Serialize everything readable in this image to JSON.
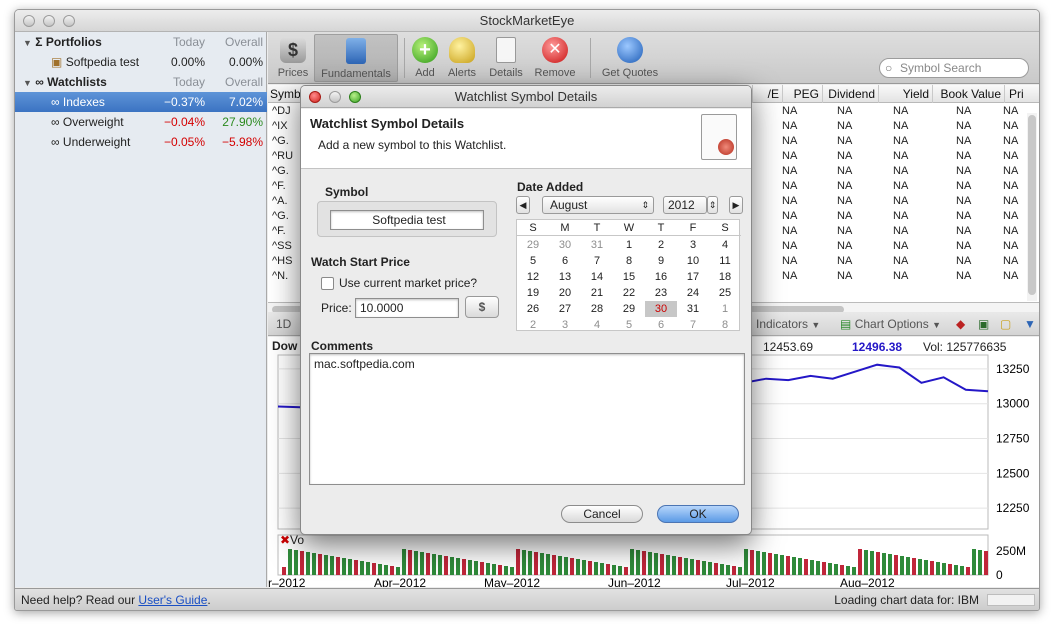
{
  "app": {
    "title": "StockMarketEye"
  },
  "sidebar": {
    "portfolios_header": {
      "label": "Portfolios",
      "today": "Today",
      "overall": "Overall"
    },
    "portfolios": [
      {
        "label": "Softpedia test",
        "today": "0.00%",
        "overall": "0.00%"
      }
    ],
    "watchlists_header": {
      "label": "Watchlists",
      "today": "Today",
      "overall": "Overall"
    },
    "watchlists": [
      {
        "label": "Indexes",
        "today": "−0.37%",
        "overall": "7.02%"
      },
      {
        "label": "Overweight",
        "today": "−0.04%",
        "overall": "27.90%"
      },
      {
        "label": "Underweight",
        "today": "−0.05%",
        "overall": "−5.98%"
      }
    ]
  },
  "toolbar": {
    "prices": "Prices",
    "fundamentals": "Fundamentals",
    "add": "Add",
    "alerts": "Alerts",
    "details": "Details",
    "remove": "Remove",
    "get_quotes": "Get Quotes"
  },
  "search": {
    "placeholder": "Symbol Search"
  },
  "table": {
    "columns": {
      "symbol": "Symbo",
      "pe": "/E",
      "peg": "PEG",
      "dividend": "Dividend",
      "yield": "Yield",
      "book_value": "Book Value",
      "pri": "Pri"
    },
    "symbols": [
      "^DJ",
      "^IX",
      "^G.",
      "^RU",
      "^G.",
      "^F.",
      "^A.",
      "^G.",
      "^F.",
      "^SS",
      "^HS",
      "^N."
    ],
    "na": "NA"
  },
  "chart_toolbar": {
    "period": "1D",
    "indicators": "Indicators",
    "chart_options": "Chart Options"
  },
  "chart": {
    "series_label": "Dow",
    "stat1": "12453.69",
    "stat2": "12496.38",
    "vol": "Vol: 125776635",
    "y_ticks": [
      "13250",
      "13000",
      "12750",
      "12500",
      "12250"
    ],
    "vol_ticks": [
      "250M",
      "0"
    ],
    "vol_label": "Vo",
    "x_labels": [
      "r–2012",
      "Apr–2012",
      "May–2012",
      "Jun–2012",
      "Jul–2012",
      "Aug–2012"
    ],
    "line_color": "#2417c7"
  },
  "chart_data": {
    "type": "line",
    "ylim": [
      12100,
      13350
    ],
    "series": [
      {
        "values": [
          12980,
          12975,
          12780,
          12820,
          12790,
          12700,
          12660,
          12600,
          12640,
          12860,
          12800,
          12700,
          12880,
          13050,
          13060,
          12960,
          12890,
          13080,
          13050,
          12920,
          13100,
          13150,
          13180,
          13170,
          13200,
          13180,
          13230,
          13280,
          13260,
          13150,
          13190,
          13100,
          13090
        ]
      }
    ]
  },
  "status": {
    "help_prefix": "Need help? Read our ",
    "guide_link": "User's Guide",
    "help_suffix": ".",
    "loading": "Loading chart data for: IBM"
  },
  "dialog": {
    "window_title": "Watchlist Symbol Details",
    "heading": "Watchlist Symbol Details",
    "subheading": "Add a new symbol to this Watchlist.",
    "symbol_label": "Symbol",
    "symbol_value": "Softpedia test",
    "watch_start_price": "Watch Start Price",
    "use_market_price": "Use current market price?",
    "price_label": "Price:",
    "price_value": "10.0000",
    "date_added": "Date Added",
    "month": "August",
    "year": "2012",
    "weekdays": [
      "S",
      "M",
      "T",
      "W",
      "T",
      "F",
      "S"
    ],
    "calendar_weeks": [
      [
        "29",
        "30",
        "31",
        "1",
        "2",
        "3",
        "4"
      ],
      [
        "5",
        "6",
        "7",
        "8",
        "9",
        "10",
        "11"
      ],
      [
        "12",
        "13",
        "14",
        "15",
        "16",
        "17",
        "18"
      ],
      [
        "19",
        "20",
        "21",
        "22",
        "23",
        "24",
        "25"
      ],
      [
        "26",
        "27",
        "28",
        "29",
        "30",
        "31",
        "1"
      ],
      [
        "2",
        "3",
        "4",
        "5",
        "6",
        "7",
        "8"
      ]
    ],
    "comments_label": "Comments",
    "comments_value": "mac.softpedia.com",
    "cancel": "Cancel",
    "ok": "OK"
  },
  "colors": {
    "selection": "#3b73c2",
    "negative": "#d40000",
    "positive": "#2b8a1f",
    "line": "#2417c7"
  }
}
